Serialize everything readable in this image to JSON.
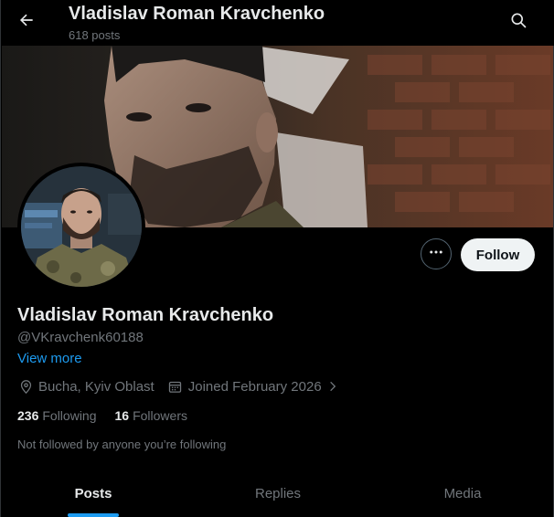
{
  "header": {
    "title": "Vladislav Roman Kravchenko",
    "posts_count": "618 posts"
  },
  "icons": {
    "back": "arrow-left-icon",
    "search": "search-icon",
    "more": "more-icon",
    "location": "location-pin-icon",
    "calendar": "calendar-icon",
    "chevron": "chevron-right-icon"
  },
  "actions": {
    "follow_label": "Follow"
  },
  "profile": {
    "name": "Vladislav Roman Kravchenko",
    "handle": "@VKravchenk60188",
    "view_more": "View more",
    "location": "Bucha, Kyiv Oblast",
    "joined": "Joined February 2026",
    "following_count": "236",
    "following_label": "Following",
    "followers_count": "16",
    "followers_label": "Followers",
    "not_followed": "Not followed by anyone you’re following"
  },
  "tabs": [
    {
      "label": "Posts",
      "active": true
    },
    {
      "label": "Replies",
      "active": false
    },
    {
      "label": "Media",
      "active": false
    }
  ],
  "colors": {
    "accent": "#1d9bf0",
    "background": "#000000",
    "text_primary": "#e7e9ea",
    "text_secondary": "#71767b"
  }
}
